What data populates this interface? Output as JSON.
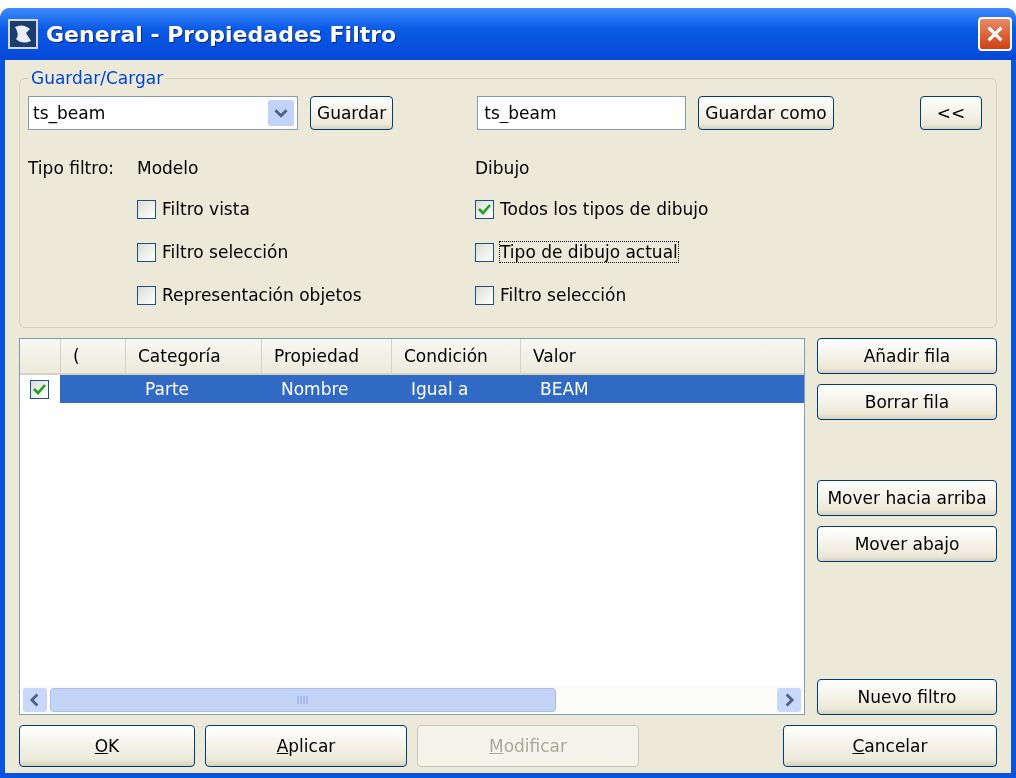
{
  "window": {
    "title": "General - Propiedades Filtro"
  },
  "save_load": {
    "legend": "Guardar/Cargar",
    "combo_value": "ts_beam",
    "save_button": "Guardar",
    "name_field_value": "ts_beam",
    "save_as_button": "Guardar como",
    "collapse_button": "<<"
  },
  "filter_type": {
    "label": "Tipo filtro:",
    "groups": [
      {
        "heading": "Modelo",
        "options": [
          {
            "label": "Filtro vista",
            "checked": false,
            "focused": false
          },
          {
            "label": "Filtro selección",
            "checked": false,
            "focused": false
          },
          {
            "label": "Representación objetos",
            "checked": false,
            "focused": false
          }
        ]
      },
      {
        "heading": "Dibujo",
        "options": [
          {
            "label": "Todos los tipos de dibujo",
            "checked": true,
            "focused": false
          },
          {
            "label": "Tipo de dibujo actual",
            "checked": false,
            "focused": true
          },
          {
            "label": "Filtro selección",
            "checked": false,
            "focused": false
          }
        ]
      }
    ]
  },
  "table": {
    "columns": [
      "(",
      "Categoría",
      "Propiedad",
      "Condición",
      "Valor"
    ],
    "rows": [
      {
        "checked": true,
        "selected": true,
        "cells": [
          "",
          "Parte",
          "Nombre",
          "Igual a",
          "BEAM"
        ]
      }
    ]
  },
  "side_buttons": [
    {
      "label": "Añadir fila"
    },
    {
      "label": "Borrar fila"
    },
    {
      "label": "Mover hacia arriba"
    },
    {
      "label": "Mover abajo"
    },
    {
      "label": "Nuevo filtro"
    }
  ],
  "bottom_buttons": [
    {
      "label": "OK",
      "disabled": false,
      "underline_first": true
    },
    {
      "label": "Aplicar",
      "disabled": false,
      "underline_first": true
    },
    {
      "label": "Modificar",
      "disabled": true,
      "underline_first": true
    },
    {
      "label": "Cancelar",
      "disabled": false,
      "underline_first": true
    }
  ]
}
